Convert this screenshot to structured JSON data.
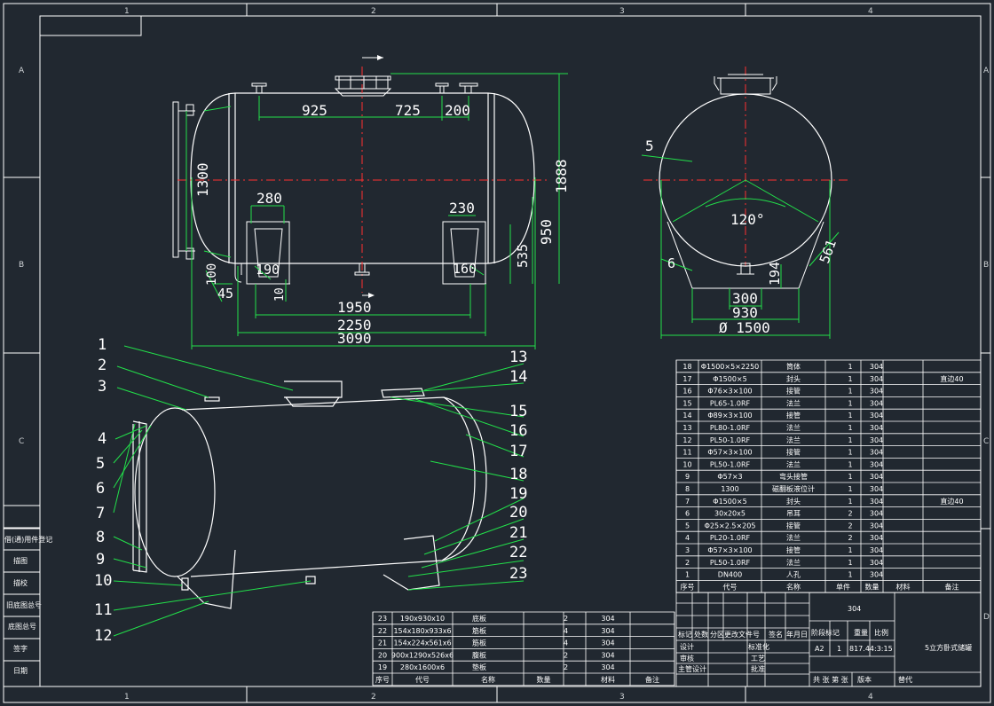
{
  "grid": {
    "columns": [
      "1",
      "2",
      "3",
      "4"
    ],
    "rows": [
      "A",
      "B",
      "C",
      "D"
    ]
  },
  "front_view": {
    "dims": {
      "d925": "925",
      "d725": "725",
      "d200": "200",
      "d1300": "1300",
      "d1888": "1888",
      "d280": "280",
      "d230": "230",
      "d950": "950",
      "d535": "535",
      "d190": "190",
      "d160": "160",
      "d100": "100",
      "d45": "45",
      "d10": "10",
      "d1950": "1950",
      "d2250": "2250",
      "d3090": "3090"
    }
  },
  "side_view": {
    "dims": {
      "d5": "5",
      "d120": "120°",
      "d6": "6",
      "d194": "194",
      "d561": "561",
      "d300": "300",
      "d930": "930",
      "d1500": "Ø 1500"
    }
  },
  "balloons": [
    "1",
    "2",
    "3",
    "4",
    "5",
    "6",
    "7",
    "8",
    "9",
    "10",
    "11",
    "12",
    "13",
    "14",
    "15",
    "16",
    "17",
    "18",
    "19",
    "20",
    "21",
    "22",
    "23"
  ],
  "bom_main": {
    "rows": [
      {
        "no": "18",
        "code": "Φ1500×5×2250",
        "name": "筒体",
        "qty": "1",
        "mat": "304",
        "note": ""
      },
      {
        "no": "17",
        "code": "Φ1500×5",
        "name": "封头",
        "qty": "1",
        "mat": "304",
        "note": "直边40"
      },
      {
        "no": "16",
        "code": "Φ76×3×100",
        "name": "接管",
        "qty": "1",
        "mat": "304",
        "note": ""
      },
      {
        "no": "15",
        "code": "PL65-1.0RF",
        "name": "法兰",
        "qty": "1",
        "mat": "304",
        "note": ""
      },
      {
        "no": "14",
        "code": "Φ89×3×100",
        "name": "接管",
        "qty": "1",
        "mat": "304",
        "note": ""
      },
      {
        "no": "13",
        "code": "PL80-1.0RF",
        "name": "法兰",
        "qty": "1",
        "mat": "304",
        "note": ""
      },
      {
        "no": "12",
        "code": "PL50-1.0RF",
        "name": "法兰",
        "qty": "1",
        "mat": "304",
        "note": ""
      },
      {
        "no": "11",
        "code": "Φ57×3×100",
        "name": "接管",
        "qty": "1",
        "mat": "304",
        "note": ""
      },
      {
        "no": "10",
        "code": "PL50-1.0RF",
        "name": "法兰",
        "qty": "1",
        "mat": "304",
        "note": ""
      },
      {
        "no": "9",
        "code": "Φ57×3",
        "name": "弯头接管",
        "qty": "1",
        "mat": "304",
        "note": ""
      },
      {
        "no": "8",
        "code": "1300",
        "name": "磁翻板液位计",
        "qty": "1",
        "mat": "304",
        "note": ""
      },
      {
        "no": "7",
        "code": "Φ1500×5",
        "name": "封头",
        "qty": "1",
        "mat": "304",
        "note": "直边40"
      },
      {
        "no": "6",
        "code": "30x20x5",
        "name": "吊耳",
        "qty": "2",
        "mat": "304",
        "note": ""
      },
      {
        "no": "5",
        "code": "Φ25×2.5×205",
        "name": "接管",
        "qty": "2",
        "mat": "304",
        "note": ""
      },
      {
        "no": "4",
        "code": "PL20-1.0RF",
        "name": "法兰",
        "qty": "2",
        "mat": "304",
        "note": ""
      },
      {
        "no": "3",
        "code": "Φ57×3×100",
        "name": "接管",
        "qty": "1",
        "mat": "304",
        "note": ""
      },
      {
        "no": "2",
        "code": "PL50-1.0RF",
        "name": "法兰",
        "qty": "1",
        "mat": "304",
        "note": ""
      },
      {
        "no": "1",
        "code": "DN400",
        "name": "人孔",
        "qty": "1",
        "mat": "304",
        "note": ""
      }
    ],
    "header": {
      "no": "序号",
      "code": "代号",
      "name": "名称",
      "qty": "数量",
      "mat": "材料",
      "single": "单件",
      "total": "总计",
      "note": "备注"
    }
  },
  "bom_lower": {
    "rows": [
      {
        "no": "23",
        "code": "190x930x10",
        "name": "底板",
        "qty": "2",
        "mat": "304"
      },
      {
        "no": "22",
        "code": "154x180x933x6",
        "name": "筋板",
        "qty": "4",
        "mat": "304"
      },
      {
        "no": "21",
        "code": "154x224x561x6",
        "name": "筋板",
        "qty": "4",
        "mat": "304"
      },
      {
        "no": "20",
        "code": "900x1290x526x6",
        "name": "腹板",
        "qty": "2",
        "mat": "304"
      },
      {
        "no": "19",
        "code": "280x1600x6",
        "name": "垫板",
        "qty": "2",
        "mat": "304"
      }
    ],
    "header": {
      "no": "序号",
      "code": "代号",
      "name": "名称",
      "qty": "数量",
      "mat": "材料",
      "note": "备注"
    }
  },
  "title_block": {
    "material": "304",
    "title": "5立方卧式储罐",
    "labels": {
      "mark": "标记",
      "count": "处数",
      "zone": "分区",
      "docno": "更改文件号",
      "sign": "签名",
      "date": "年月日",
      "stage": "阶段标记",
      "weight": "重量",
      "scale": "比例",
      "design": "设计",
      "standard": "标准化",
      "check": "审核",
      "process": "工艺",
      "chief": "主管设计",
      "approve": "批准",
      "sheet_total": "共 张 第 张",
      "version": "版本",
      "replace": "替代"
    },
    "values": {
      "stage": "A2",
      "weight": "1",
      "scale": "817.44:3:15"
    }
  },
  "left_strip": [
    "借(通)用件登记",
    "旧底图总号",
    "底图总号",
    "签字",
    "日期",
    "描图",
    "描校"
  ]
}
